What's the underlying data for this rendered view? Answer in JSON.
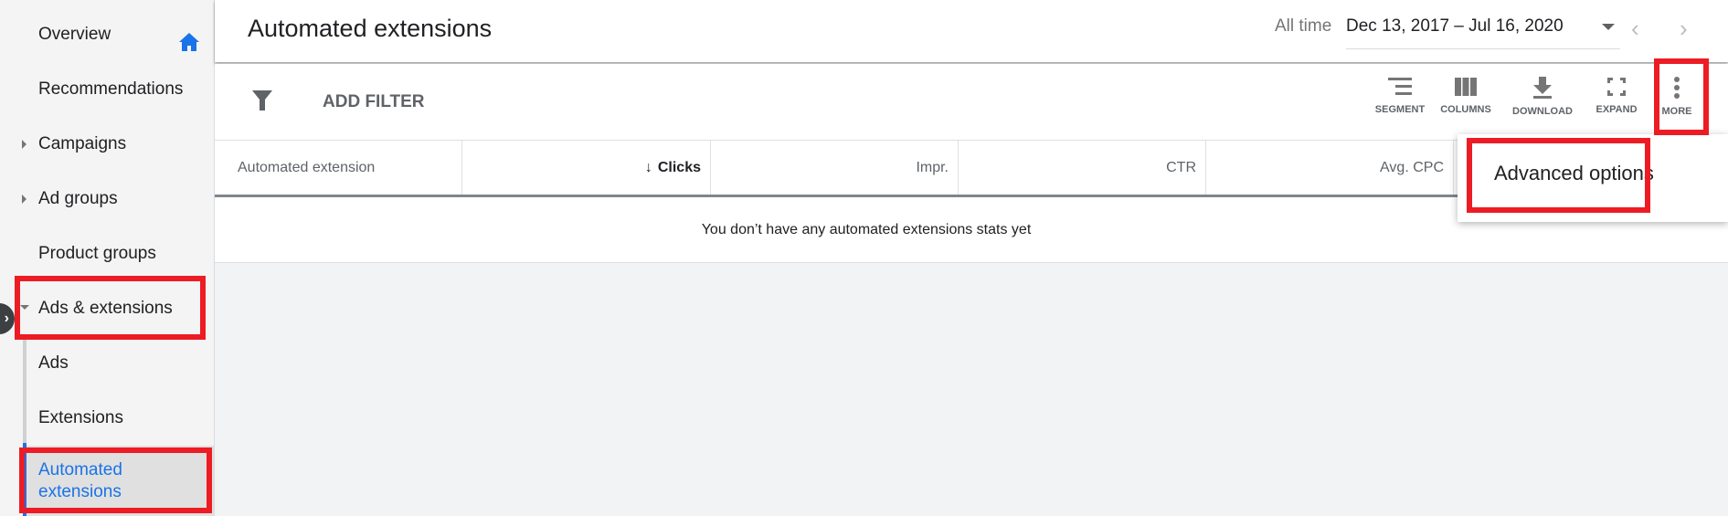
{
  "sidebar": {
    "items": [
      {
        "label": "Overview",
        "icon": "home-icon"
      },
      {
        "label": "Recommendations"
      },
      {
        "label": "Campaigns",
        "expandable": true
      },
      {
        "label": "Ad groups",
        "expandable": true
      },
      {
        "label": "Product groups"
      },
      {
        "label": "Ads & extensions",
        "expanded": true
      },
      {
        "label": "Ads"
      },
      {
        "label": "Extensions"
      },
      {
        "label": "Automated extensions",
        "active": true
      }
    ]
  },
  "header": {
    "title": "Automated extensions",
    "date_preset": "All time",
    "date_range": "Dec 13, 2017 – Jul 16, 2020"
  },
  "toolbar": {
    "add_filter": "ADD FILTER",
    "segment": "SEGMENT",
    "columns": "COLUMNS",
    "download": "DOWNLOAD",
    "expand": "EXPAND",
    "more": "MORE"
  },
  "table": {
    "columns": [
      "Automated extension",
      "Clicks",
      "Impr.",
      "CTR",
      "Avg. CPC",
      ""
    ],
    "sorted_column": "Clicks",
    "sort_direction": "descending",
    "empty_message": "You don’t have any automated extensions stats yet"
  },
  "more_menu": {
    "items": [
      "Advanced options"
    ]
  },
  "colors": {
    "accent": "#1a73e8",
    "highlight": "#ed1c24"
  }
}
